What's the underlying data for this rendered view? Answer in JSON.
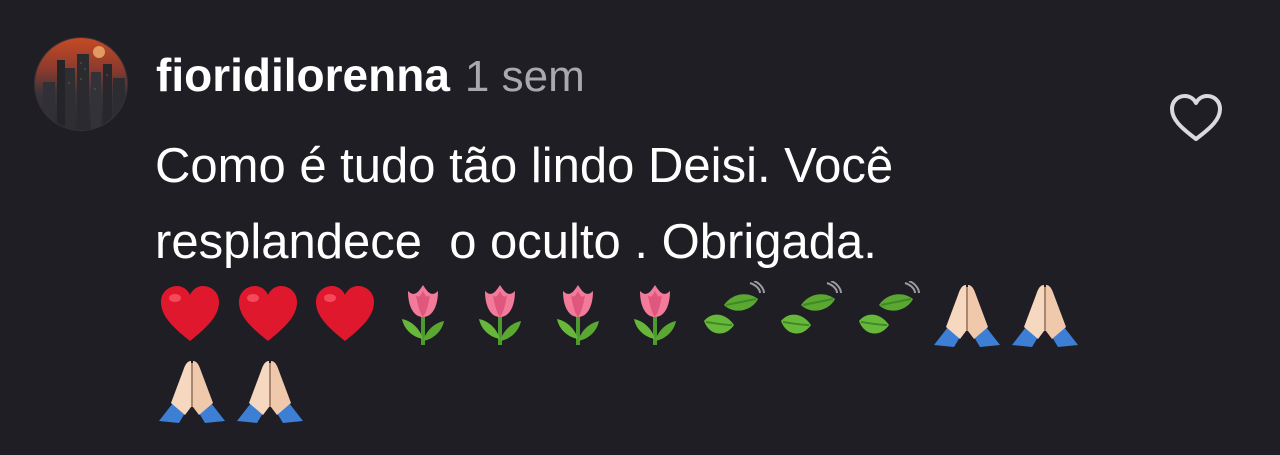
{
  "comment": {
    "username": "fioridilorenna",
    "timestamp": "1 sem",
    "text": "Como é tudo tão lindo Deisi. Você\nresplandece  o oculto . Obrigada.",
    "emoji_line_1": [
      "red-heart",
      "red-heart",
      "red-heart",
      "tulip",
      "tulip",
      "tulip",
      "tulip",
      "leaf-fluttering-in-wind",
      "leaf-fluttering-in-wind",
      "leaf-fluttering-in-wind",
      "folded-hands",
      "folded-hands"
    ],
    "emoji_line_2": [
      "folded-hands",
      "folded-hands"
    ]
  },
  "icons": {
    "like": "heart-outline-icon",
    "avatar": "profile-avatar"
  },
  "colors": {
    "background": "#1f1e24",
    "text": "#ffffff",
    "timestamp": "#a8a8ad",
    "heart_red": "#e0182d",
    "tulip_pink": "#f27a9a",
    "leaf_green": "#67b83a",
    "hands_skin": "#f6d7bf",
    "sleeve_blue": "#3e7fd6",
    "like_icon": "#d9d9de"
  }
}
